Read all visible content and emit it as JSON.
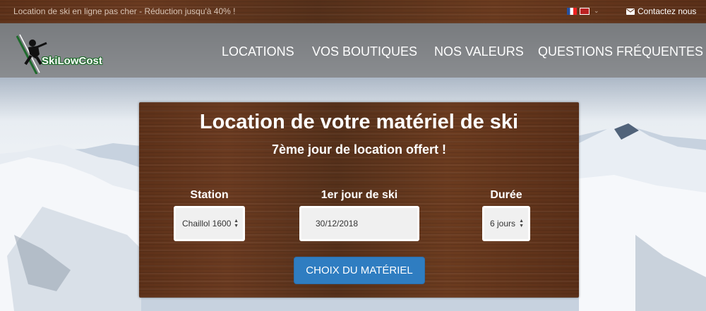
{
  "topbar": {
    "promo_text": "Location de ski en ligne pas cher - Réduction jusqu'à 40% !",
    "contact_label": "Contactez nous",
    "languages": [
      "fr-flag-icon",
      "uk-flag-icon"
    ]
  },
  "navbar": {
    "logo_text": "SkiLowCost",
    "items": [
      {
        "label": "LOCATIONS"
      },
      {
        "label": "VOS BOUTIQUES"
      },
      {
        "label": "NOS VALEURS"
      },
      {
        "label": "QUESTIONS FRÉQUENTES"
      }
    ]
  },
  "booking": {
    "title": "Location de votre matériel de ski",
    "subtitle": "7ème jour de location offert !",
    "station": {
      "label": "Station",
      "value": "Chaillol 1600"
    },
    "date": {
      "label": "1er jour de ski",
      "value": "30/12/2018"
    },
    "duration": {
      "label": "Durée",
      "value": "6 jours"
    },
    "submit_label": "CHOIX DU MATÉRIEL"
  },
  "colors": {
    "wood": "#5a2f19",
    "button": "#2f7dc1",
    "navbar": "#808080"
  }
}
